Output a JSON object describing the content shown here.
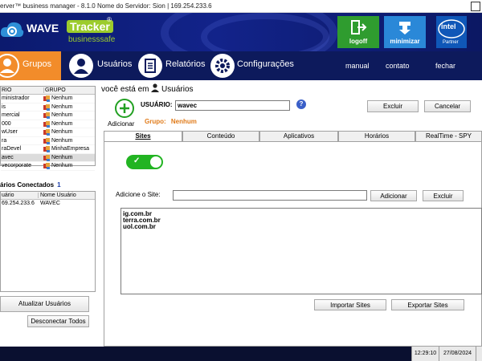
{
  "window": {
    "title": "erver™ business manager - 8.1.0   Nome do Servidor: Sion | 169.254.233.6"
  },
  "header": {
    "logo_wave": "WAVE",
    "logo_tracker": "Tracker",
    "logo_reg": "®",
    "logo_sub": "businesssafe",
    "logoff_label": "logoff",
    "minimizar_label": "minimizar",
    "intel_label": "intel",
    "intel_partner": "Partner"
  },
  "nav": {
    "grupos": "Grupos",
    "usuarios": "Usuários",
    "relatorios": "Relatórios",
    "configuracoes": "Configurações",
    "manual": "manual",
    "contato": "contato",
    "fechar": "fechar"
  },
  "users_grid": {
    "col_user": "RIO",
    "col_group": "GRUPO",
    "rows": [
      {
        "user": "ministrador",
        "group": "Nenhum"
      },
      {
        "user": "is",
        "group": "Nenhum"
      },
      {
        "user": "mercial",
        "group": "Nenhum"
      },
      {
        "user": "000",
        "group": "Nenhum"
      },
      {
        "user": "wUser",
        "group": "Nenhum"
      },
      {
        "user": "ra",
        "group": "Nenhum"
      },
      {
        "user": "raDevel",
        "group": "MinhaEmpresa"
      },
      {
        "user": "avec",
        "group": "Nenhum"
      },
      {
        "user": "vecorporate",
        "group": "Nenhum"
      }
    ],
    "selected_index": 7
  },
  "connected": {
    "label": "ários Conectados",
    "count": "1",
    "col_ip": "uário",
    "col_name": "Nome Usuário",
    "rows": [
      {
        "ip": "69.254.233.6",
        "name": "WAVEC"
      }
    ]
  },
  "left_buttons": {
    "atualizar": "Atualizar Usuários",
    "desconectar": "Desconectar Todos"
  },
  "main": {
    "breadcrumb_prefix": "você está em",
    "breadcrumb_page": "Usuários",
    "add_label": "Adicionar",
    "usuario_label": "USUÁRIO:",
    "usuario_value": "wavec",
    "help": "?",
    "grupo_label": "Grupo:",
    "grupo_value": "Nenhum",
    "excluir": "Excluir",
    "cancelar": "Cancelar"
  },
  "tabs": [
    "Sites",
    "Conteúdo",
    "Aplicativos",
    "Horários",
    "RealTime - SPY"
  ],
  "active_tab": 0,
  "sites": {
    "toggle_on": true,
    "toggle_check": "✓",
    "add_label": "Adicione o Site:",
    "add_value": "",
    "adicionar": "Adicionar",
    "excluir": "Excluir",
    "list": [
      "ig.com.br",
      "terra.com.br",
      "uol.com.br"
    ],
    "importar": "Importar Sites",
    "exportar": "Exportar Sites"
  },
  "taskbar": {
    "time": "12:29:10",
    "date": "27/08/2024"
  },
  "colors": {
    "accent_orange": "#f28c2a",
    "nav_bg": "#0d1a5c",
    "toggle_green": "#22b422",
    "logoff_green": "#2f9c2f",
    "minimizar_blue": "#2a88d8"
  }
}
